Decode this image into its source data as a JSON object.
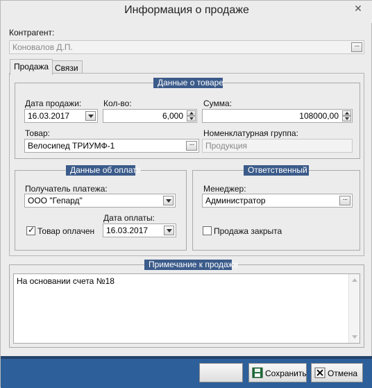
{
  "window": {
    "title": "Информация о продаже"
  },
  "contractor": {
    "label": "Контрагент:",
    "value": "Коновалов Д.П."
  },
  "tabs": [
    {
      "label": "Продажа"
    },
    {
      "label": "Связи"
    }
  ],
  "product_group": {
    "title": "Данные о товаре",
    "sale_date_label": "Дата продажи:",
    "sale_date": "16.03.2017",
    "qty_label": "Кол-во:",
    "qty": "6,000",
    "sum_label": "Сумма:",
    "sum": "108000,00",
    "product_label": "Товар:",
    "product": "Велосипед ТРИУМФ-1",
    "nomen_label": "Номенклатурная группа:",
    "nomen": "Продукция"
  },
  "payment_group": {
    "title": "Данные об оплате",
    "recipient_label": "Получатель платежа:",
    "recipient": "ООО \"Гепард\"",
    "paid_label": "Товар оплачен",
    "paid_checked": true,
    "pay_date_label": "Дата оплаты:",
    "pay_date": "16.03.2017"
  },
  "responsible_group": {
    "title": "Ответственный",
    "manager_label": "Менеджер:",
    "manager": "Администратор",
    "closed_label": "Продажа закрыта",
    "closed_checked": false
  },
  "note_group": {
    "title": "Примечание к продаже",
    "text": "На основании счета №18"
  },
  "buttons": {
    "blank": "",
    "save": "Сохранить",
    "cancel": "Отмена"
  },
  "icons": {
    "close": "close-icon",
    "save": "floppy-disk-icon",
    "cancel": "cancel-x-icon"
  },
  "colors": {
    "group_header": "#3b5b8a",
    "bottom_bar": "#2d5f9a"
  }
}
